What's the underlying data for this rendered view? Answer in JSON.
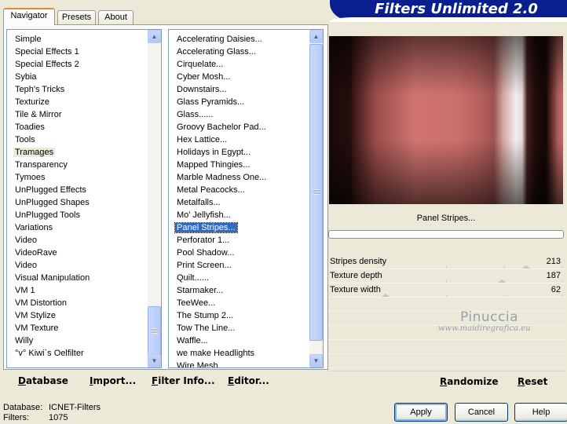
{
  "header": {
    "title": "Filters Unlimited 2.0"
  },
  "tabs": [
    {
      "label": "Navigator"
    },
    {
      "label": "Presets"
    },
    {
      "label": "About"
    }
  ],
  "categories": {
    "selected": "Tramages",
    "items": [
      "Simple",
      "Special Effects 1",
      "Special Effects 2",
      "Sybia",
      "Teph's Tricks",
      "Texturize",
      "Tile & Mirror",
      "Toadies",
      "Tools",
      "Tramages",
      "Transparency",
      "Tymoes",
      "UnPlugged Effects",
      "UnPlugged Shapes",
      "UnPlugged Tools",
      "Variations",
      "Video",
      "VideoRave",
      "Video",
      "Visual Manipulation",
      "VM 1",
      "VM Distortion",
      "VM Stylize",
      "VM Texture",
      "Willy",
      "°v° Kiwi`s Oelfilter"
    ]
  },
  "filters": {
    "selected": "Panel Stripes...",
    "items": [
      "Accelerating Daisies...",
      "Accelerating Glass...",
      "Cirquelate...",
      "Cyber Mosh...",
      "Downstairs...",
      "Glass Pyramids...",
      "Glass......",
      "Groovy Bachelor Pad...",
      "Hex Lattice...",
      "Holidays in Egypt...",
      "Mapped Thingies...",
      "Marble Madness One...",
      "Metal Peacocks...",
      "Metalfalls...",
      "Mo' Jellyfish...",
      "Panel Stripes...",
      "Perforator 1...",
      "Pool Shadow...",
      "Print Screen...",
      "Quilt......",
      "Starmaker...",
      "TeeWee...",
      "The Stump 2...",
      "Tow The Line...",
      "Waffle...",
      "we make Headlights",
      "Wire Mesh..."
    ]
  },
  "left_buttons": {
    "database": "Database",
    "import": "Import...",
    "filter_info": "Filter Info...",
    "editor": "Editor..."
  },
  "preview": {
    "filter_name": "Panel Stripes..."
  },
  "params": [
    {
      "label": "Stripes density",
      "value": "213",
      "level": 0.835
    },
    {
      "label": "Texture depth",
      "value": "187",
      "level": 0.733
    },
    {
      "label": "Texture width",
      "value": "62",
      "level": 0.243
    }
  ],
  "right_buttons": {
    "randomize": "Randomize",
    "reset": "Reset"
  },
  "watermark": {
    "name": "Pinuccia",
    "site": "www.maidiregrafica.eu"
  },
  "status": {
    "database_label": "Database:",
    "database_value": "ICNET-Filters",
    "filters_label": "Filters:",
    "filters_value": "1075"
  },
  "dialog_buttons": {
    "apply": "Apply",
    "cancel": "Cancel",
    "help": "Help"
  }
}
